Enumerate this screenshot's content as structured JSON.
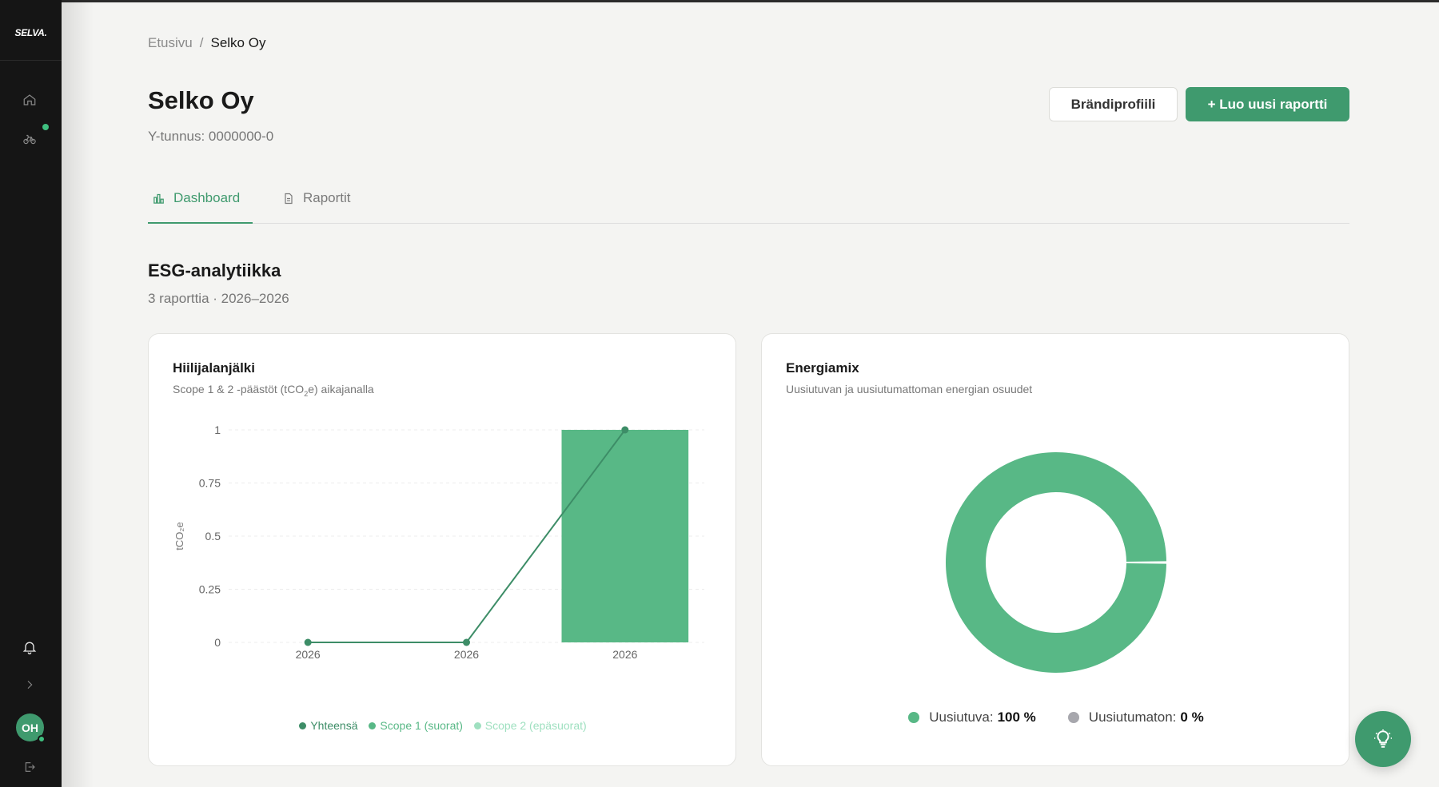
{
  "colors": {
    "accent": "#3f9a6e",
    "chart_green": "#58b886",
    "chart_line": "#3d8d67",
    "scope2": "#9fe0c0",
    "non_renewable": "#a7a7ad",
    "sidebar": "#151515"
  },
  "sidebar": {
    "logo": "SELVA.",
    "icons": [
      "home-icon",
      "bicycle-icon",
      "bell-icon",
      "chevron-right-icon",
      "logout-icon"
    ],
    "avatar_initials": "OH"
  },
  "breadcrumb": {
    "home": "Etusivu",
    "separator": "/",
    "current": "Selko Oy"
  },
  "header": {
    "title": "Selko Oy",
    "business_id": "Y-tunnus: 0000000-0",
    "brand_button": "Brändiprofiili",
    "new_report_button": "+ Luo uusi raportti"
  },
  "tabs": [
    {
      "label": "Dashboard",
      "icon": "bar-chart-icon",
      "active": true
    },
    {
      "label": "Raportit",
      "icon": "document-icon",
      "active": false
    }
  ],
  "section": {
    "title": "ESG-analytiikka",
    "subtitle": "3 raporttia · 2026–2026"
  },
  "carbon_card": {
    "title": "Hiilijalanjälki",
    "subtitle_pre": "Scope 1 & 2 -päästöt (tCO",
    "subtitle_sub": "2",
    "subtitle_post": "e) aikajanalla",
    "legend": [
      "Yhteensä",
      "Scope 1 (suorat)",
      "Scope 2 (epäsuorat)"
    ]
  },
  "energy_card": {
    "title": "Energiamix",
    "subtitle": "Uusiutuvan ja uusiutumattoman energian osuudet",
    "renewable_label": "Uusiutuva:",
    "renewable_value": "100 %",
    "nonrenewable_label": "Uusiutumaton:",
    "nonrenewable_value": "0 %"
  },
  "chart_data": [
    {
      "type": "bar",
      "title": "Hiilijalanjälki",
      "ylabel": "tCO₂e",
      "xlabel": "",
      "categories": [
        "2026",
        "2026",
        "2026"
      ],
      "ylim": [
        0,
        1
      ],
      "yticks": [
        "0",
        "0.25",
        "0.5",
        "0.75",
        "1"
      ],
      "series": [
        {
          "name": "Yhteensä",
          "kind": "line",
          "values": [
            0,
            0,
            1
          ]
        },
        {
          "name": "Scope 1 (suorat)",
          "kind": "bar",
          "values": [
            0,
            0,
            1
          ]
        },
        {
          "name": "Scope 2 (epäsuorat)",
          "kind": "bar",
          "values": [
            0,
            0,
            0
          ]
        }
      ],
      "grid": true,
      "legend": "bottom"
    },
    {
      "type": "pie",
      "title": "Energiamix",
      "donut": true,
      "categories": [
        "Uusiutuva",
        "Uusiutumaton"
      ],
      "values": [
        100,
        0
      ],
      "legend": "bottom"
    }
  ]
}
